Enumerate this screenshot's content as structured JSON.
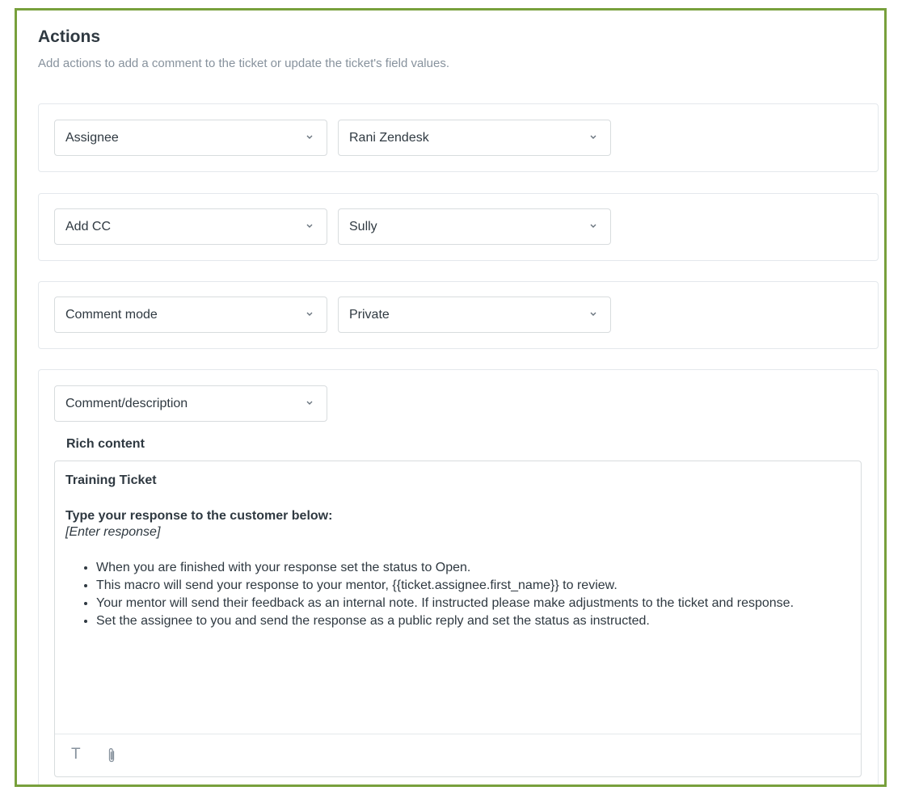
{
  "section": {
    "title": "Actions",
    "description": "Add actions to add a comment to the ticket or update the ticket's field values."
  },
  "actions": [
    {
      "field": "Assignee",
      "value": "Rani Zendesk"
    },
    {
      "field": "Add CC",
      "value": "Sully"
    },
    {
      "field": "Comment mode",
      "value": "Private"
    }
  ],
  "comment_action": {
    "field": "Comment/description",
    "rich_content_label": "Rich content",
    "editor": {
      "title": "Training Ticket",
      "prompt": "Type your response to the customer below:",
      "placeholder": "[Enter response]",
      "bullets": [
        "When you are finished with your response set the status to Open.",
        "This macro will send your response to your mentor, {{ticket.assignee.first_name}} to review.",
        "Your mentor will send their feedback as an internal note. If instructed please make adjustments to the ticket and response.",
        "Set the assignee to you and send the response as a public reply and set the status as instructed."
      ],
      "toolbar": {
        "text_format_icon": "T",
        "attach_icon": "paperclip-icon"
      }
    }
  },
  "colors": {
    "frame_border": "#78a03c",
    "text": "#2f3941",
    "muted": "#87929d"
  }
}
